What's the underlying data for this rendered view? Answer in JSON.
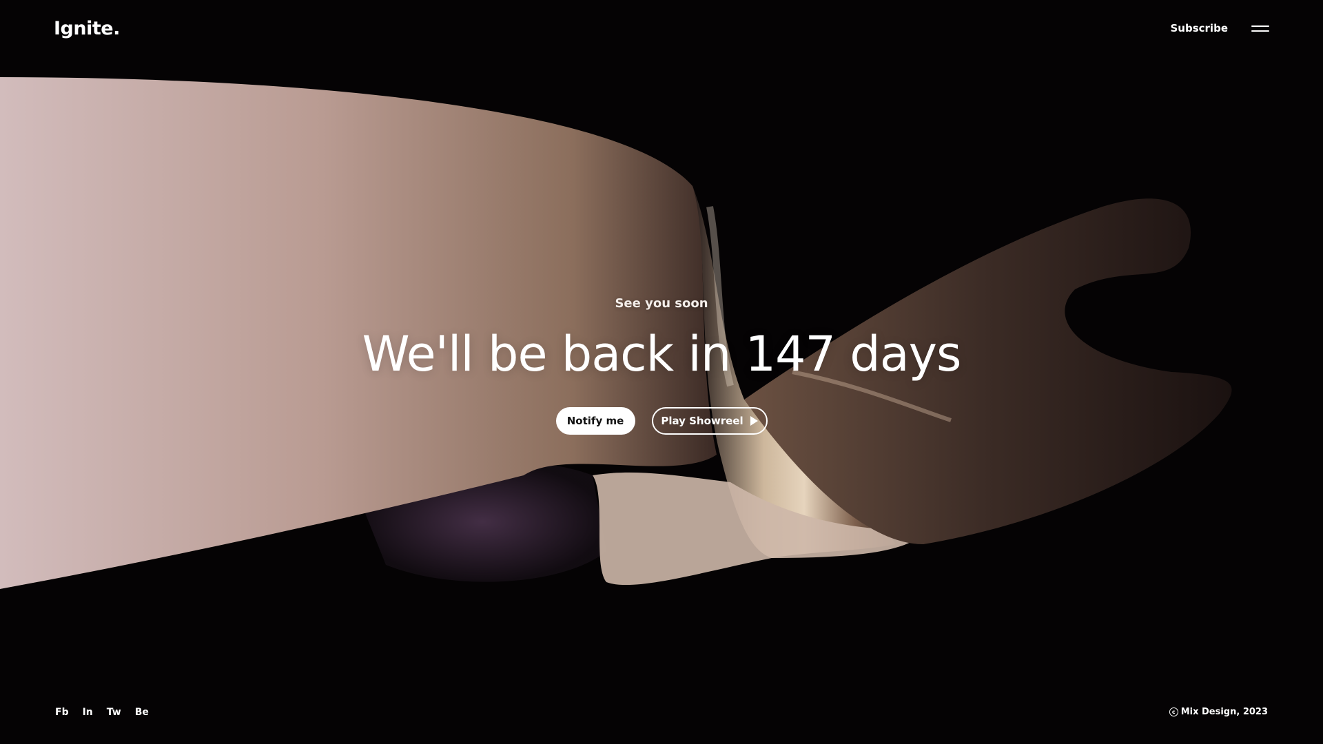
{
  "brand": {
    "logo": "Ignite."
  },
  "nav": {
    "subscribe_label": "Subscribe",
    "menu_icon": "hamburger-menu-icon"
  },
  "hero": {
    "eyebrow": "See you soon",
    "headline": "We'll be back in 147 days",
    "notify_label": "Notify me",
    "showreel_label": "Play Showreel",
    "showreel_icon": "play-icon"
  },
  "footer": {
    "social": [
      "Fb",
      "In",
      "Tw",
      "Be"
    ],
    "copyright": "Mix Design, 2023",
    "copyright_icon": "copyright-icon"
  },
  "colors": {
    "background": "#050304",
    "text": "#ffffff",
    "ribbon_light": "#d6c3c0",
    "ribbon_mid": "#a58a72",
    "ribbon_dark": "#2a1e1a",
    "ribbon_shadow_purple": "#3d2a40"
  }
}
